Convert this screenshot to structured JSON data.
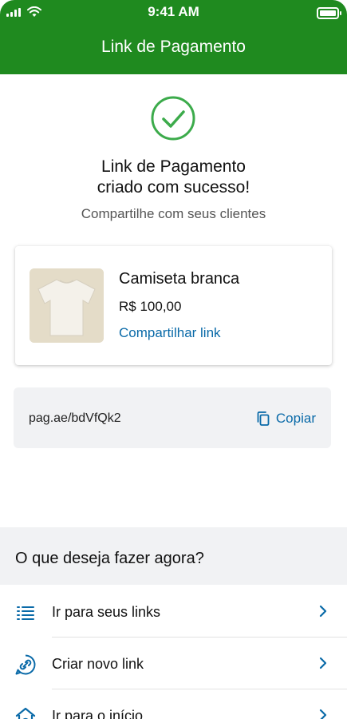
{
  "status": {
    "time": "9:41 AM"
  },
  "header": {
    "title": "Link de Pagamento"
  },
  "success": {
    "line1": "Link de Pagamento",
    "line2": "criado com sucesso!",
    "subtitle": "Compartilhe com seus clientes"
  },
  "product": {
    "name": "Camiseta branca",
    "price": "R$ 100,00",
    "share_label": "Compartilhar link"
  },
  "link": {
    "url": "pag.ae/bdVfQk2",
    "copy_label": "Copiar"
  },
  "next": {
    "title": "O que deseja fazer agora?",
    "items": [
      {
        "label": "Ir para seus links",
        "icon": "list-icon"
      },
      {
        "label": "Criar novo link",
        "icon": "link-chat-icon"
      },
      {
        "label": "Ir para o início",
        "icon": "home-icon"
      }
    ]
  },
  "colors": {
    "brand": "#1f8a1f",
    "accent": "#0a6aa8",
    "success": "#3cab4b"
  }
}
